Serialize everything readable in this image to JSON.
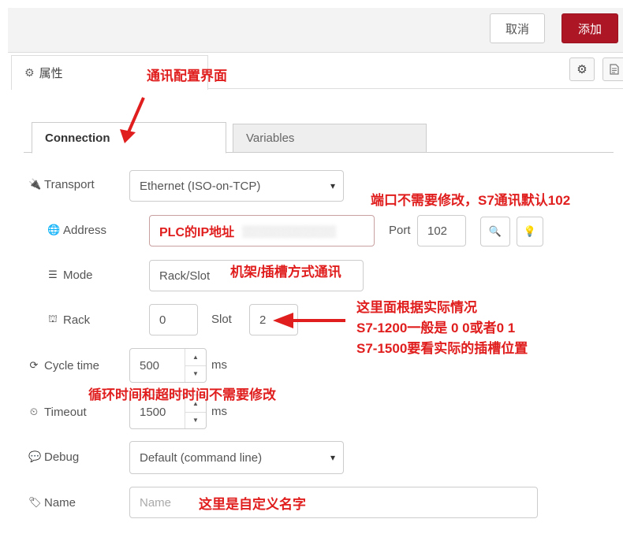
{
  "header": {
    "cancel_label": "取消",
    "add_label": "添加"
  },
  "properties_tab": {
    "label": "属性"
  },
  "tabs": {
    "connection": "Connection",
    "variables": "Variables"
  },
  "form": {
    "transport": {
      "label": "Transport",
      "value": "Ethernet (ISO-on-TCP)"
    },
    "address": {
      "label": "Address",
      "value": "PLC的IP地址",
      "port_label": "Port",
      "port_value": "102"
    },
    "mode": {
      "label": "Mode",
      "value": "Rack/Slot"
    },
    "rack": {
      "label": "Rack",
      "value": "0",
      "slot_label": "Slot",
      "slot_value": "2"
    },
    "cycle_time": {
      "label": "Cycle time",
      "value": "500",
      "unit": "ms"
    },
    "timeout": {
      "label": "Timeout",
      "value": "1500",
      "unit": "ms"
    },
    "debug": {
      "label": "Debug",
      "value": "Default (command line)"
    },
    "name": {
      "label": "Name",
      "placeholder": "Name"
    }
  },
  "annotations": {
    "config_ui": "通讯配置界面",
    "port": "端口不需要修改，S7通讯默认102",
    "mode": "机架/插槽方式通讯",
    "rack_line1": "这里面根据实际情况",
    "rack_line2": "S7-1200一般是 0 0或者0 1",
    "rack_line3": "S7-1500要看实际的插槽位置",
    "timing": "循环时间和超时时间不需要修改",
    "name": "这里是自定义名字"
  },
  "colors": {
    "accent": "#ad1625",
    "annotation": "#e01e1e"
  }
}
